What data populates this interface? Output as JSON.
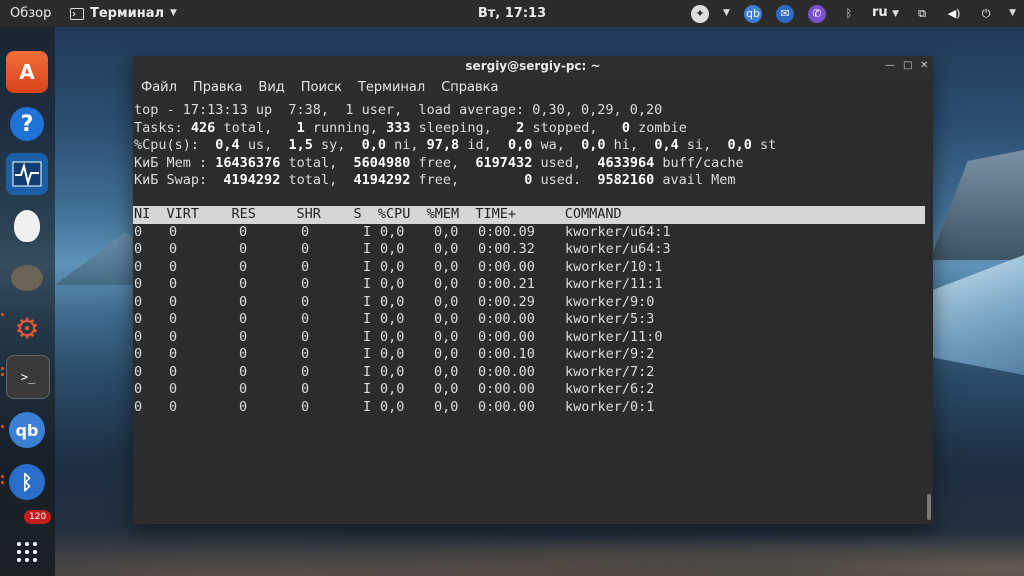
{
  "panel": {
    "activities": "Обзор",
    "app_name": "Терминал",
    "clock": "Вт, 17:13",
    "keyboard_layout": "ru"
  },
  "dock": {
    "badge_count": "120",
    "items": [
      "Ubuntu Software",
      "Help",
      "System Monitor",
      "Egg",
      "GIMP",
      "Settings",
      "Terminal",
      "qBittorrent",
      "Bluetooth",
      "Show Applications"
    ]
  },
  "terminal": {
    "title": "sergiy@sergiy-pc: ~",
    "menu": [
      "Файл",
      "Правка",
      "Вид",
      "Поиск",
      "Терминал",
      "Справка"
    ],
    "summary": {
      "line1": "top - 17:13:13 up  7:38,  1 user,  load average: 0,30, 0,29, 0,20",
      "tasks_label": "Tasks:",
      "tasks_total": "426",
      "tasks_total_label": "total,",
      "tasks_running": "1",
      "tasks_running_label": "running,",
      "tasks_sleeping": "333",
      "tasks_sleeping_label": "sleeping,",
      "tasks_stopped": "2",
      "tasks_stopped_label": "stopped,",
      "tasks_zombie": "0",
      "tasks_zombie_label": "zombie",
      "cpu_label": "%Cpu(s):",
      "cpu_us": "0,4",
      "cpu_sy": "1,5",
      "cpu_ni": "0,0",
      "cpu_id": "97,8",
      "cpu_wa": "0,0",
      "cpu_hi": "0,0",
      "cpu_si": "0,4",
      "cpu_st": "0,0",
      "mem_label": "КиБ Mem :",
      "mem_total": "16436376",
      "mem_free": "5604980",
      "mem_used": "6197432",
      "mem_buff": "4633964",
      "swap_label": "КиБ Swap:",
      "swap_total": "4194292",
      "swap_free": "4194292",
      "swap_used": "0",
      "swap_avail": "9582160"
    },
    "header": "NI  VIRT    RES     SHR    S  %CPU  %MEM  TIME+      COMMAND",
    "processes": [
      {
        "ni": "0",
        "virt": "0",
        "res": "0",
        "shr": "0",
        "s": "I",
        "cpu": "0,0",
        "mem": "0,0",
        "time": "0:00.09",
        "command": "kworker/u64:1"
      },
      {
        "ni": "0",
        "virt": "0",
        "res": "0",
        "shr": "0",
        "s": "I",
        "cpu": "0,0",
        "mem": "0,0",
        "time": "0:00.32",
        "command": "kworker/u64:3"
      },
      {
        "ni": "0",
        "virt": "0",
        "res": "0",
        "shr": "0",
        "s": "I",
        "cpu": "0,0",
        "mem": "0,0",
        "time": "0:00.00",
        "command": "kworker/10:1"
      },
      {
        "ni": "0",
        "virt": "0",
        "res": "0",
        "shr": "0",
        "s": "I",
        "cpu": "0,0",
        "mem": "0,0",
        "time": "0:00.21",
        "command": "kworker/11:1"
      },
      {
        "ni": "0",
        "virt": "0",
        "res": "0",
        "shr": "0",
        "s": "I",
        "cpu": "0,0",
        "mem": "0,0",
        "time": "0:00.29",
        "command": "kworker/9:0"
      },
      {
        "ni": "0",
        "virt": "0",
        "res": "0",
        "shr": "0",
        "s": "I",
        "cpu": "0,0",
        "mem": "0,0",
        "time": "0:00.00",
        "command": "kworker/5:3"
      },
      {
        "ni": "0",
        "virt": "0",
        "res": "0",
        "shr": "0",
        "s": "I",
        "cpu": "0,0",
        "mem": "0,0",
        "time": "0:00.00",
        "command": "kworker/11:0"
      },
      {
        "ni": "0",
        "virt": "0",
        "res": "0",
        "shr": "0",
        "s": "I",
        "cpu": "0,0",
        "mem": "0,0",
        "time": "0:00.10",
        "command": "kworker/9:2"
      },
      {
        "ni": "0",
        "virt": "0",
        "res": "0",
        "shr": "0",
        "s": "I",
        "cpu": "0,0",
        "mem": "0,0",
        "time": "0:00.00",
        "command": "kworker/7:2"
      },
      {
        "ni": "0",
        "virt": "0",
        "res": "0",
        "shr": "0",
        "s": "I",
        "cpu": "0,0",
        "mem": "0,0",
        "time": "0:00.00",
        "command": "kworker/6:2"
      },
      {
        "ni": "0",
        "virt": "0",
        "res": "0",
        "shr": "0",
        "s": "I",
        "cpu": "0,0",
        "mem": "0,0",
        "time": "0:00.00",
        "command": "kworker/0:1"
      }
    ]
  }
}
